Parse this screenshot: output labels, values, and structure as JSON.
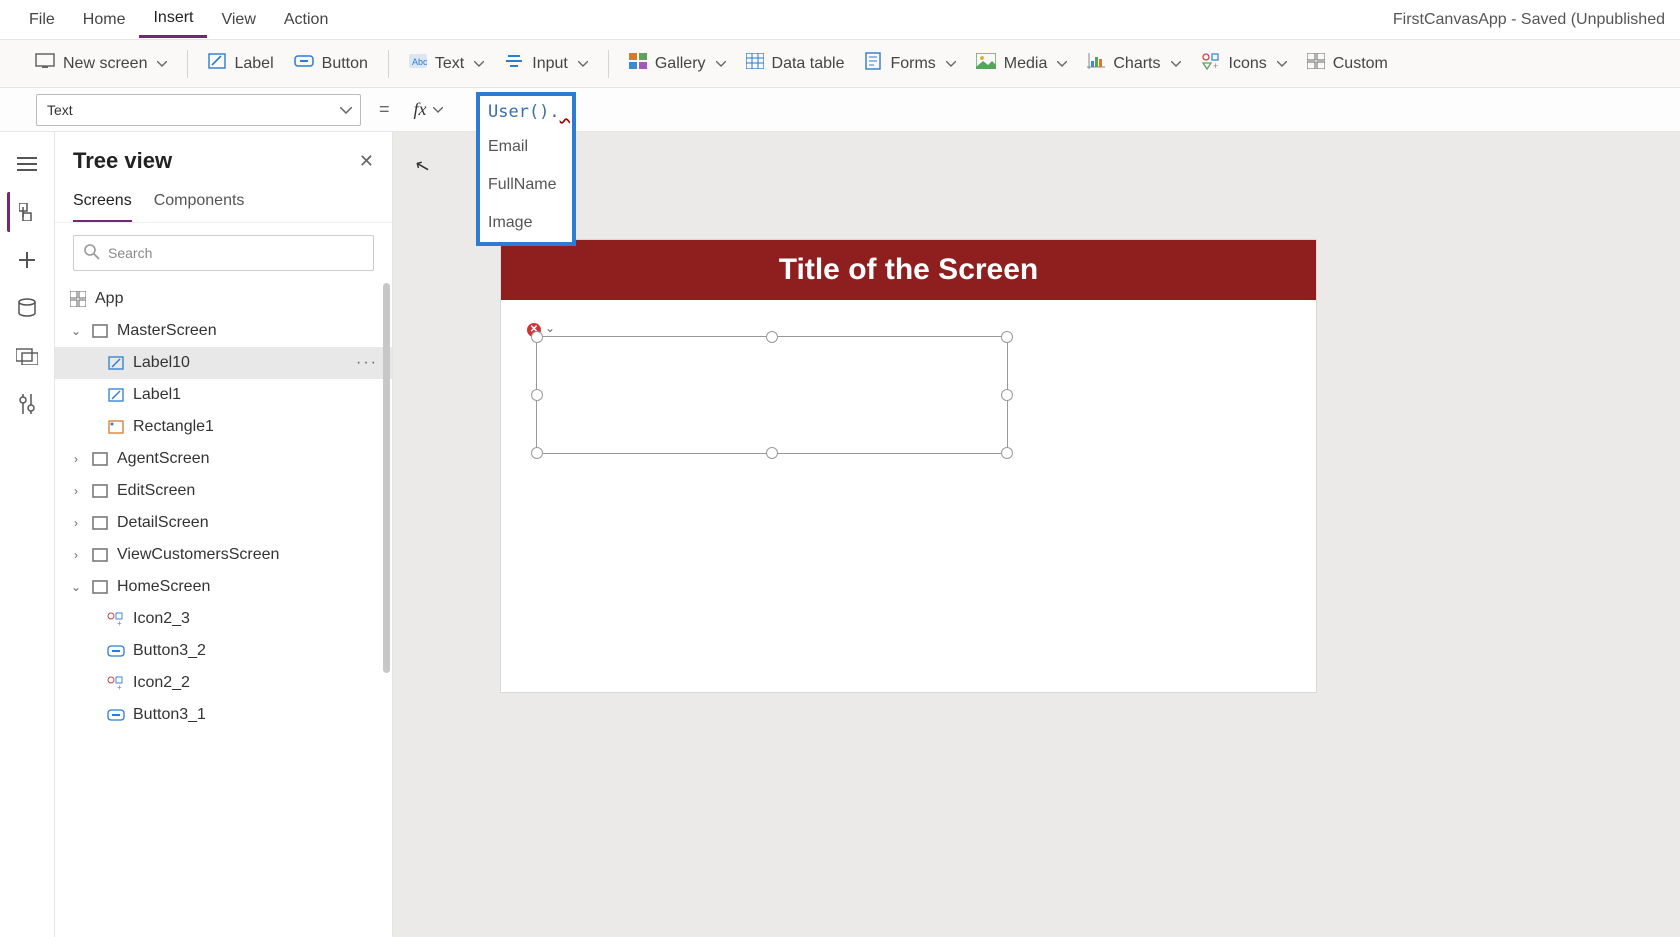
{
  "menu": {
    "file": "File",
    "home": "Home",
    "insert": "Insert",
    "view": "View",
    "action": "Action"
  },
  "app_title": "FirstCanvasApp - Saved (Unpublished",
  "ribbon": {
    "new_screen": "New screen",
    "label": "Label",
    "button": "Button",
    "text": "Text",
    "input": "Input",
    "gallery": "Gallery",
    "data_table": "Data table",
    "forms": "Forms",
    "media": "Media",
    "charts": "Charts",
    "icons": "Icons",
    "custom": "Custom"
  },
  "property_selector": "Text",
  "formula": "User().",
  "intellisense": {
    "options": [
      "Email",
      "FullName",
      "Image"
    ]
  },
  "tree": {
    "title": "Tree view",
    "tab_screens": "Screens",
    "tab_components": "Components",
    "search_placeholder": "Search",
    "app": "App",
    "items": [
      {
        "label": "MasterScreen",
        "type": "screen",
        "expanded": true
      },
      {
        "label": "Label10",
        "type": "label",
        "selected": true
      },
      {
        "label": "Label1",
        "type": "label"
      },
      {
        "label": "Rectangle1",
        "type": "rect"
      },
      {
        "label": "AgentScreen",
        "type": "screen",
        "collapsed": true
      },
      {
        "label": "EditScreen",
        "type": "screen",
        "collapsed": true
      },
      {
        "label": "DetailScreen",
        "type": "screen",
        "collapsed": true
      },
      {
        "label": "ViewCustomersScreen",
        "type": "screen",
        "collapsed": true
      },
      {
        "label": "HomeScreen",
        "type": "screen",
        "expanded": true
      },
      {
        "label": "Icon2_3",
        "type": "icon"
      },
      {
        "label": "Button3_2",
        "type": "button"
      },
      {
        "label": "Icon2_2",
        "type": "icon"
      },
      {
        "label": "Button3_1",
        "type": "button"
      }
    ]
  },
  "canvas": {
    "header_title": "Title of the Screen"
  }
}
